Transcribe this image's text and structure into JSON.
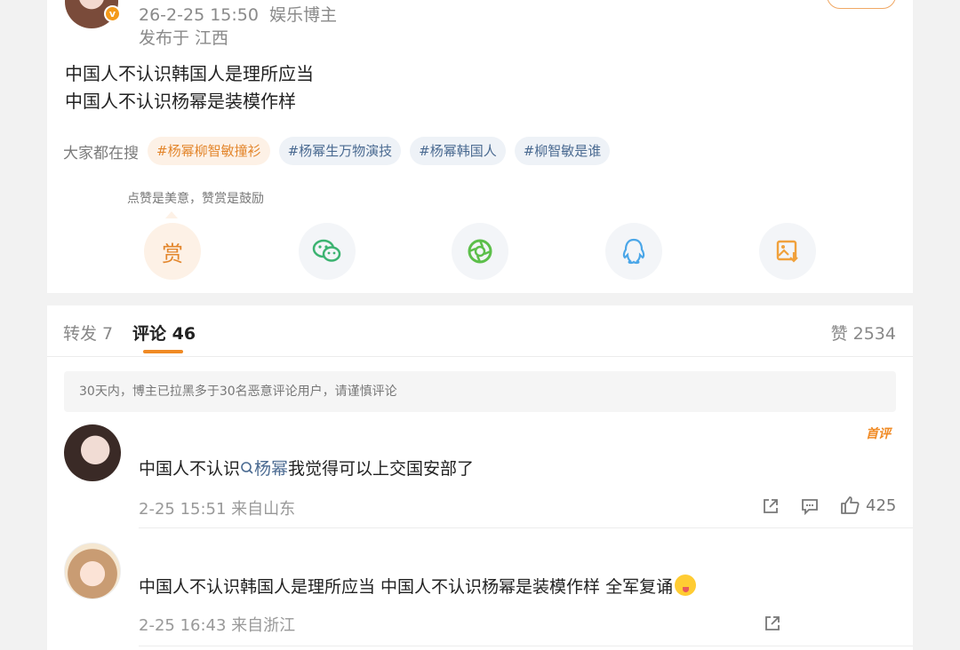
{
  "post": {
    "date": "26-2-25 15:50",
    "author_tag": "娱乐博主",
    "location": "发布于 江西",
    "text_line1": "中国人不认识韩国人是理所应当",
    "text_line2": "中国人不认识杨幂是装模作样",
    "search_label": "大家都在搜",
    "hashtags": [
      "#杨幂柳智敏撞衫",
      "#杨幂生万物演技",
      "#杨幂韩国人",
      "#柳智敏是谁"
    ],
    "reward_hint": "点赞是美意，赞赏是鼓励",
    "reward_label": "赏",
    "verified_badge": "v",
    "share_icons": [
      "reward-icon",
      "wechat-icon",
      "moments-icon",
      "qq-icon",
      "save-image-icon"
    ],
    "accent_color": "#f08a24"
  },
  "tabs": {
    "repost": "转发 7",
    "comments": "评论 46",
    "likes": "赞 2534"
  },
  "notice": "30天内，博主已拉黑多于30名恶意评论用户，请谨慎评论",
  "comments": [
    {
      "badge": "首评",
      "text_prefix": "中国人不认识",
      "mention_icon": "Q",
      "mention": "杨幂",
      "text_suffix": "我觉得可以上交国安部了",
      "meta": "2-25 15:51 来自山东",
      "likes": "425"
    },
    {
      "text": "中国人不认识韩国人是理所应当 中国人不认识杨幂是装模作样 全军复诵",
      "emoji": "tongue-out-emoji",
      "meta": "2-25 16:43 来自浙江"
    }
  ]
}
